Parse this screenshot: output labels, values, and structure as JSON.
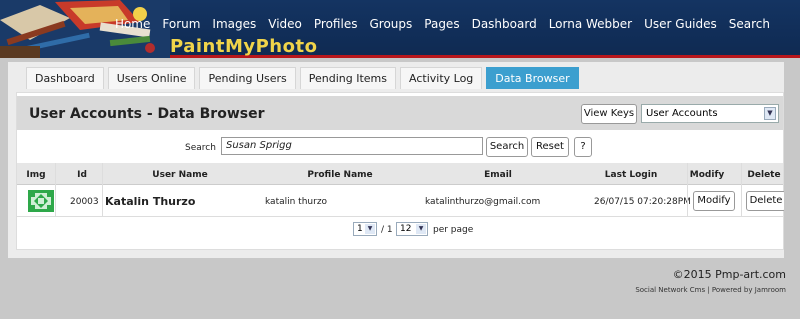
{
  "header": {
    "site_name": "PaintMyPhoto",
    "nav": [
      "Home",
      "Forum",
      "Images",
      "Video",
      "Profiles",
      "Groups",
      "Pages",
      "Dashboard",
      "Lorna Webber",
      "User Guides",
      "Search"
    ]
  },
  "tabs": [
    {
      "label": "Dashboard",
      "active": false
    },
    {
      "label": "Users Online",
      "active": false
    },
    {
      "label": "Pending Users",
      "active": false
    },
    {
      "label": "Pending Items",
      "active": false
    },
    {
      "label": "Activity Log",
      "active": false
    },
    {
      "label": "Data Browser",
      "active": true
    }
  ],
  "main": {
    "title": "User Accounts - Data Browser",
    "view_keys_label": "View Keys",
    "datastore_select": "User Accounts"
  },
  "search": {
    "label": "Search",
    "value": "Susan Sprigg",
    "search_label": "Search",
    "reset_label": "Reset",
    "help_label": "?"
  },
  "table": {
    "columns": [
      "Img",
      "Id",
      "User Name",
      "Profile Name",
      "Email",
      "Last Login",
      "Modify",
      "Delete"
    ],
    "rows": [
      {
        "id": "20003",
        "user_name": "Katalin Thurzo",
        "profile_name": "katalin thurzo",
        "email": "katalinthurzo@gmail.com",
        "last_login": "26/07/15 07:20:28PM",
        "modify_label": "Modify",
        "delete_label": "Delete"
      }
    ]
  },
  "pager": {
    "page": "1",
    "of_label": "/ 1",
    "per_page": "12",
    "per_page_label": "per page"
  },
  "footer": {
    "copyright": "©2015 Pmp-art.com",
    "powered": "Social Network Cms | Powered by Jamroom"
  }
}
